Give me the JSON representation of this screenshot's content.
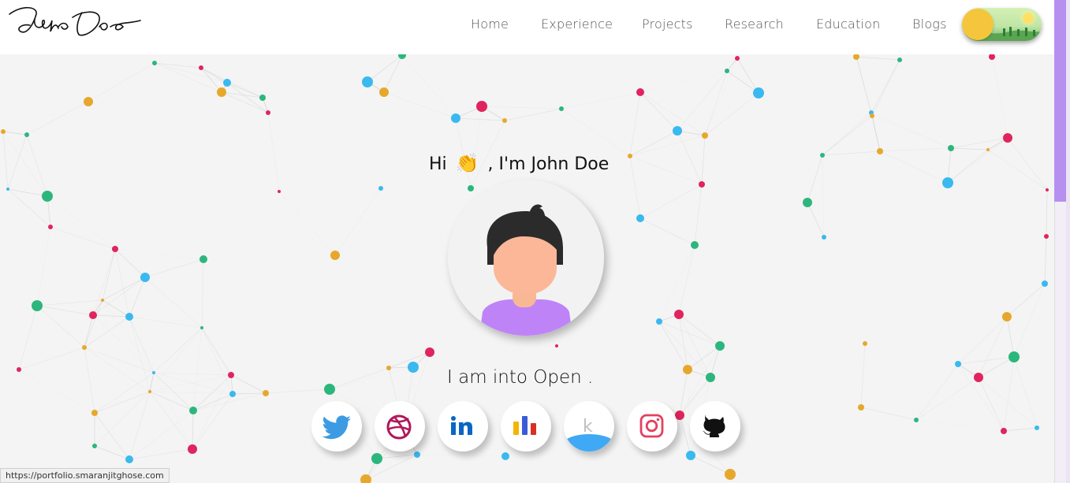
{
  "header": {
    "logo_text": "John Doe",
    "nav": [
      {
        "label": "Home"
      },
      {
        "label": "Experience"
      },
      {
        "label": "Projects"
      },
      {
        "label": "Research"
      },
      {
        "label": "Education"
      },
      {
        "label": "Blogs"
      }
    ],
    "theme_toggle": {
      "state": "light"
    }
  },
  "hero": {
    "greeting_prefix": "Hi",
    "greeting_emoji": "👏",
    "greeting_middle": ", I'm",
    "name": "John Doe",
    "tagline": "I am into Open ."
  },
  "social_links": [
    {
      "name": "twitter-icon",
      "color": "#3c9be3"
    },
    {
      "name": "dribbble-icon",
      "color": "#c2185b"
    },
    {
      "name": "linkedin-icon",
      "color": "#0a66c2"
    },
    {
      "name": "analytics-icon",
      "color": "#3b5bd6"
    },
    {
      "name": "kaggle-icon",
      "color": "#20beff"
    },
    {
      "name": "instagram-icon",
      "color": "#e4405f"
    },
    {
      "name": "github-icon",
      "color": "#111111"
    }
  ],
  "status_bar": {
    "url": "https://portfolio.smaranjitghose.com"
  },
  "colors": {
    "scroll_thumb": "#b690f0",
    "node_colors": [
      "#e6a82c",
      "#2cb67d",
      "#e0245e",
      "#39b9ef"
    ]
  }
}
